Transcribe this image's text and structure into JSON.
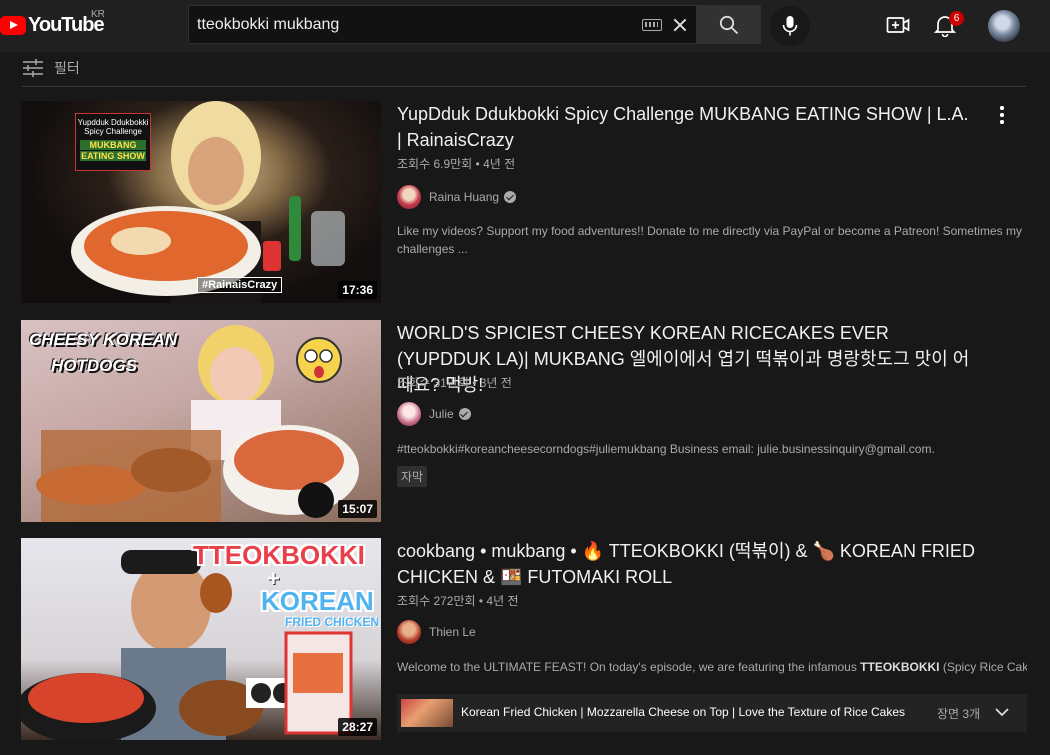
{
  "header": {
    "logo_text": "YouTube",
    "region": "KR",
    "search_value": "tteokbokki mukbang",
    "notification_count": "6"
  },
  "filter": {
    "label": "필터"
  },
  "results": [
    {
      "title": "YupDduk Ddukbokki Spicy Challenge MUKBANG EATING SHOW | L.A. | RainaisCrazy",
      "meta": "조회수 6.9만회 • 4년 전",
      "channel": "Raina Huang",
      "verified": true,
      "description": "Like my videos? Support my food adventures!! Donate to me directly via PayPal or become a Patreon! Sometimes my challenges ...",
      "duration": "17:36",
      "thumb_text_1": "Yupdduk Ddukbokki",
      "thumb_text_2": "Spicy Challenge",
      "thumb_text_3": "MUKBANG",
      "thumb_text_4": "EATING SHOW",
      "thumb_tag": "#RainaisCrazy"
    },
    {
      "title": "WORLD'S SPICIEST CHEESY KOREAN RICECAKES EVER (YUPDDUK LA)| MUKBANG 엘에이에서 엽기 떡볶이과 명랑핫도그 맛이 어때요? 먹방!",
      "meta": "조회수 31만회 • 3년 전",
      "channel": "Julie",
      "verified": true,
      "description": "#tteokbokki#koreancheesecorndogs#juliemukbang Business email: julie.businessinquiry@gmail.com.",
      "badge": "자막",
      "duration": "15:07",
      "thumb_text_1": "CHEESY KOREAN",
      "thumb_text_2": "HOTDOGS"
    },
    {
      "title": "cookbang • mukbang • 🔥 TTEOKBOKKI (떡볶이) & 🍗 KOREAN FRIED CHICKEN & 🍱 FUTOMAKI ROLL",
      "meta": "조회수 272만회 • 4년 전",
      "channel": "Thien Le",
      "verified": false,
      "description_prefix": "Welcome to the ULTIMATE FEAST! On today's episode, we are featuring the infamous ",
      "description_bold": "TTEOKBOKKI",
      "description_suffix": " (Spicy Rice Cake...",
      "duration": "28:27",
      "thumb_text_1": "TTEOKBOKKI",
      "thumb_text_2": "+",
      "thumb_text_3": "KOREAN",
      "thumb_text_4": "FRIED CHICKEN",
      "chapter_title": "Korean Fried Chicken | Mozzarella Cheese on Top | Love the Texture of Rice Cakes",
      "chapter_count": "장면 3개"
    }
  ],
  "colors": {
    "background": "#181818",
    "topbar": "#202020",
    "brand_red": "#ff0000",
    "badge_red": "#cc0000"
  }
}
